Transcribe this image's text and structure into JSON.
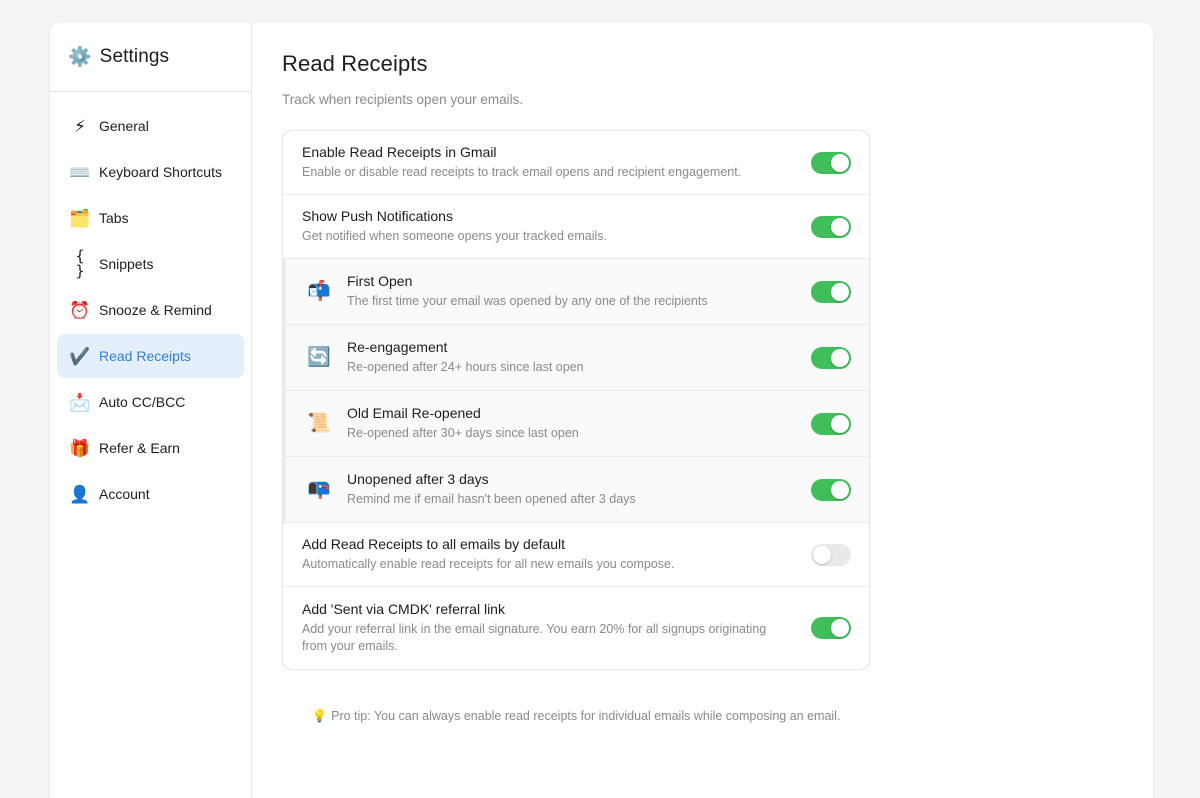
{
  "sidebar": {
    "title": "Settings",
    "title_icon": "⚙️",
    "items": [
      {
        "label": "General",
        "icon": "⚡"
      },
      {
        "label": "Keyboard Shortcuts",
        "icon": "⌨️"
      },
      {
        "label": "Tabs",
        "icon": "🗂️"
      },
      {
        "label": "Snippets",
        "icon": "{ }"
      },
      {
        "label": "Snooze & Remind",
        "icon": "⏰"
      },
      {
        "label": "Read Receipts",
        "icon": "✔️",
        "active": true
      },
      {
        "label": "Auto CC/BCC",
        "icon": "📩"
      },
      {
        "label": "Refer & Earn",
        "icon": "🎁"
      },
      {
        "label": "Account",
        "icon": "👤"
      }
    ]
  },
  "main": {
    "title": "Read Receipts",
    "subtitle": "Track when recipients open your emails.",
    "settings": [
      {
        "title": "Enable Read Receipts in Gmail",
        "desc": "Enable or disable read receipts to track email opens and recipient engagement.",
        "on": true
      },
      {
        "title": "Show Push Notifications",
        "desc": "Get notified when someone opens your tracked emails.",
        "on": true
      },
      {
        "title": "First Open",
        "desc": "The first time your email was opened by any one of the recipients",
        "icon": "📬",
        "on": true
      },
      {
        "title": "Re-engagement",
        "desc": "Re-opened after 24+ hours since last open",
        "icon": "🔄",
        "on": true
      },
      {
        "title": "Old Email Re-opened",
        "desc": "Re-opened after 30+ days since last open",
        "icon": "📜",
        "on": true
      },
      {
        "title": "Unopened after 3 days",
        "desc": "Remind me if email hasn't been opened after 3 days",
        "icon": "📭",
        "on": true
      },
      {
        "title": "Add Read Receipts to all emails by default",
        "desc": "Automatically enable read receipts for all new emails you compose.",
        "on": false
      },
      {
        "title": "Add 'Sent via CMDK' referral link",
        "desc": "Add your referral link in the email signature. You earn 20% for all signups originating from your emails.",
        "on": true
      }
    ],
    "tip_icon": "💡",
    "tip": "Pro tip: You can always enable read receipts for individual emails while composing an email."
  },
  "colors": {
    "accent": "#2f7fd8",
    "toggle_on": "#3fbe5a",
    "toggle_off": "#e9e9ec",
    "active_bg": "#e4effb"
  }
}
